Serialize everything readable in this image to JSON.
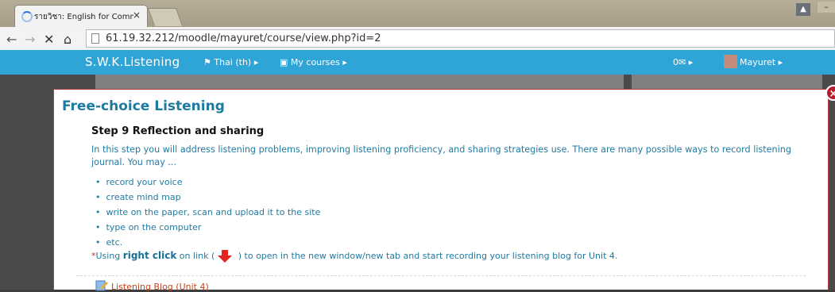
{
  "browser": {
    "tab_title": "รายวิชา: English for Comm",
    "tab_close": "×",
    "user_icon": "person-icon",
    "url": "61.19.32.212/moodle/mayuret/course/view.php?id=2"
  },
  "navbar": {
    "brand": "S.W.K.Listening",
    "language": "Thai (th) ▸",
    "courses": "My courses ▸",
    "messages": "0✉ ▸",
    "user": "Mayuret ▸",
    "color": "#2fa4d7"
  },
  "modal": {
    "close": "×",
    "title": "Free-choice Listening",
    "step_title": "Step 9 Reflection and sharing",
    "intro": "In this step you will address listening problems, improving listening proficiency, and sharing strategies use.  There are many possible ways to record listening journal. You may ...",
    "bullets": [
      "record your voice",
      "create mind map",
      "write on the paper, scan and upload it to the site",
      "type on the computer",
      "etc."
    ],
    "note_star": "*",
    "note_pre": "Using ",
    "note_bold": "right click",
    "note_mid": " on link (",
    "note_post": " ) to open in the new window/new tab and start recording your listening blog for Unit 4.",
    "blog_link": "Listening Blog (Unit 4)"
  }
}
